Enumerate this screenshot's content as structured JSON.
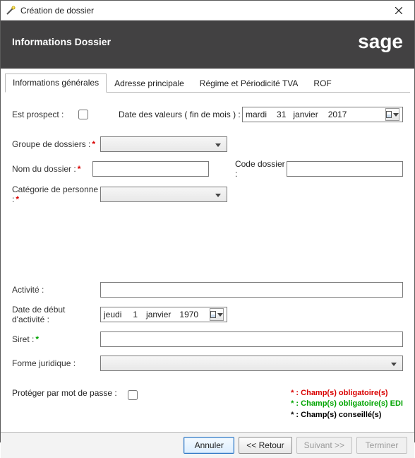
{
  "window": {
    "title": "Création de dossier"
  },
  "header": {
    "title": "Informations Dossier",
    "brand": "sage"
  },
  "tabs": [
    {
      "label": "Informations générales",
      "active": true
    },
    {
      "label": "Adresse principale",
      "active": false
    },
    {
      "label": "Régime et Périodicité TVA",
      "active": false
    },
    {
      "label": "ROF",
      "active": false
    }
  ],
  "fields": {
    "est_prospect_label": "Est prospect :",
    "est_prospect_value": false,
    "date_valeurs_label": "Date des valeurs ( fin de mois ) :",
    "date_valeurs": {
      "dayname": "mardi",
      "day": "31",
      "month": "janvier",
      "year": "2017"
    },
    "groupe_dossiers_label": "Groupe de dossiers :",
    "groupe_dossiers_value": "",
    "nom_dossier_label": "Nom du dossier :",
    "nom_dossier_value": "",
    "code_dossier_label": "Code dossier :",
    "code_dossier_value": "",
    "categorie_personne_label": "Catégorie de personne :",
    "categorie_personne_value": "",
    "activite_label": "Activité :",
    "activite_value": "",
    "date_debut_label": "Date de début d'activité :",
    "date_debut": {
      "dayname": "jeudi",
      "day": "1",
      "month": "janvier",
      "year": "1970"
    },
    "siret_label": "Siret :",
    "siret_value": "",
    "forme_juridique_label": "Forme juridique :",
    "forme_juridique_value": "",
    "proteger_label": "Protéger par mot de passe :",
    "proteger_value": false
  },
  "legend": {
    "red": "* : Champ(s) obligatoire(s)",
    "green": "* : Champ(s) obligatoire(s) EDI",
    "black": "* : Champ(s) conseillé(s)"
  },
  "buttons": {
    "annuler": "Annuler",
    "retour": "<< Retour",
    "suivant": "Suivant >>",
    "terminer": "Terminer"
  }
}
